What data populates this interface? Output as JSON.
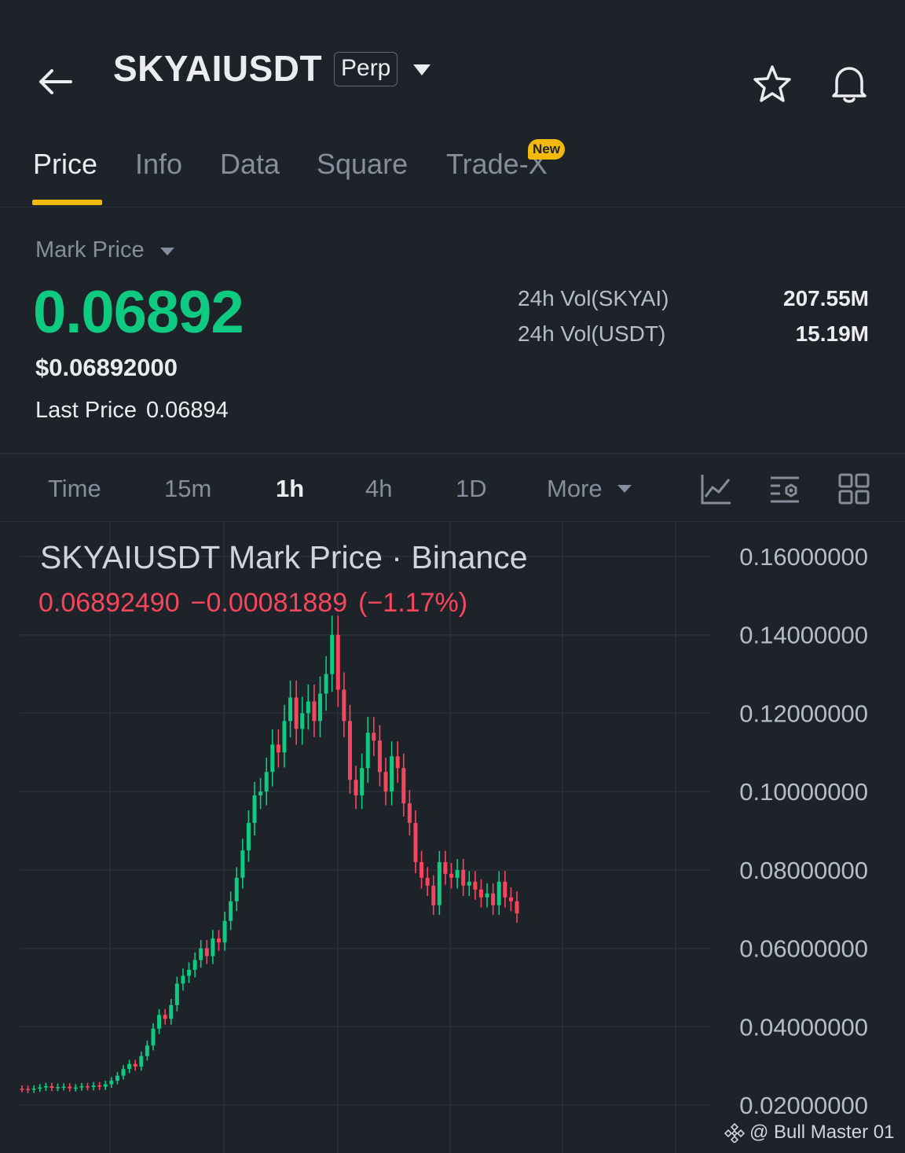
{
  "header": {
    "title": "SKYAIUSDT",
    "badge": "Perp"
  },
  "tabs": [
    {
      "label": "Price",
      "active": true
    },
    {
      "label": "Info"
    },
    {
      "label": "Data"
    },
    {
      "label": "Square"
    },
    {
      "label": "Trade-X",
      "badge": "New"
    }
  ],
  "price_panel": {
    "selector_label": "Mark Price",
    "mark_price": "0.06892",
    "usd_price": "$0.06892000",
    "last_price_label": "Last Price",
    "last_price_value": "0.06894",
    "volumes": [
      {
        "label": "24h Vol(SKYAI)",
        "value": "207.55M"
      },
      {
        "label": "24h Vol(USDT)",
        "value": "15.19M"
      }
    ]
  },
  "timeframes": {
    "items": [
      "Time",
      "15m",
      "1h",
      "4h",
      "1D"
    ],
    "active": "1h",
    "more_label": "More"
  },
  "chart": {
    "title": "SKYAIUSDT Mark Price · Binance",
    "last_value": "0.06892490",
    "change": "−0.00081889",
    "change_pct": "(−1.17%)"
  },
  "colors": {
    "up": "#0ecb81",
    "down": "#f6465d",
    "accent": "#f0b90b",
    "background": "#1e2329"
  },
  "watermark": "@ Bull Master 01",
  "chart_data": {
    "type": "line",
    "series_style": "candlestick",
    "interval": "1h",
    "y_ticks": [
      "0.16000000",
      "0.14000000",
      "0.12000000",
      "0.10000000",
      "0.08000000",
      "0.06000000",
      "0.04000000",
      "0.02000000"
    ],
    "ylim": [
      0.02,
      0.16
    ],
    "grid": true,
    "y_axis_side": "right",
    "close_values": [
      0.0241,
      0.0239,
      0.0242,
      0.0245,
      0.0248,
      0.0244,
      0.0246,
      0.0247,
      0.0243,
      0.0245,
      0.0248,
      0.0246,
      0.025,
      0.0247,
      0.0253,
      0.0262,
      0.0275,
      0.0292,
      0.0305,
      0.0298,
      0.0325,
      0.0352,
      0.0395,
      0.043,
      0.042,
      0.0455,
      0.051,
      0.053,
      0.0545,
      0.057,
      0.06,
      0.058,
      0.0625,
      0.0615,
      0.067,
      0.072,
      0.078,
      0.085,
      0.092,
      0.099,
      0.1,
      0.105,
      0.112,
      0.11,
      0.118,
      0.124,
      0.116,
      0.12,
      0.123,
      0.118,
      0.125,
      0.13,
      0.14,
      0.126,
      0.118,
      0.103,
      0.099,
      0.106,
      0.115,
      0.113,
      0.105,
      0.1,
      0.109,
      0.106,
      0.097,
      0.092,
      0.082,
      0.078,
      0.076,
      0.071,
      0.082,
      0.079,
      0.078,
      0.08,
      0.076,
      0.077,
      0.075,
      0.073,
      0.074,
      0.071,
      0.077,
      0.073,
      0.072,
      0.0689
    ]
  }
}
